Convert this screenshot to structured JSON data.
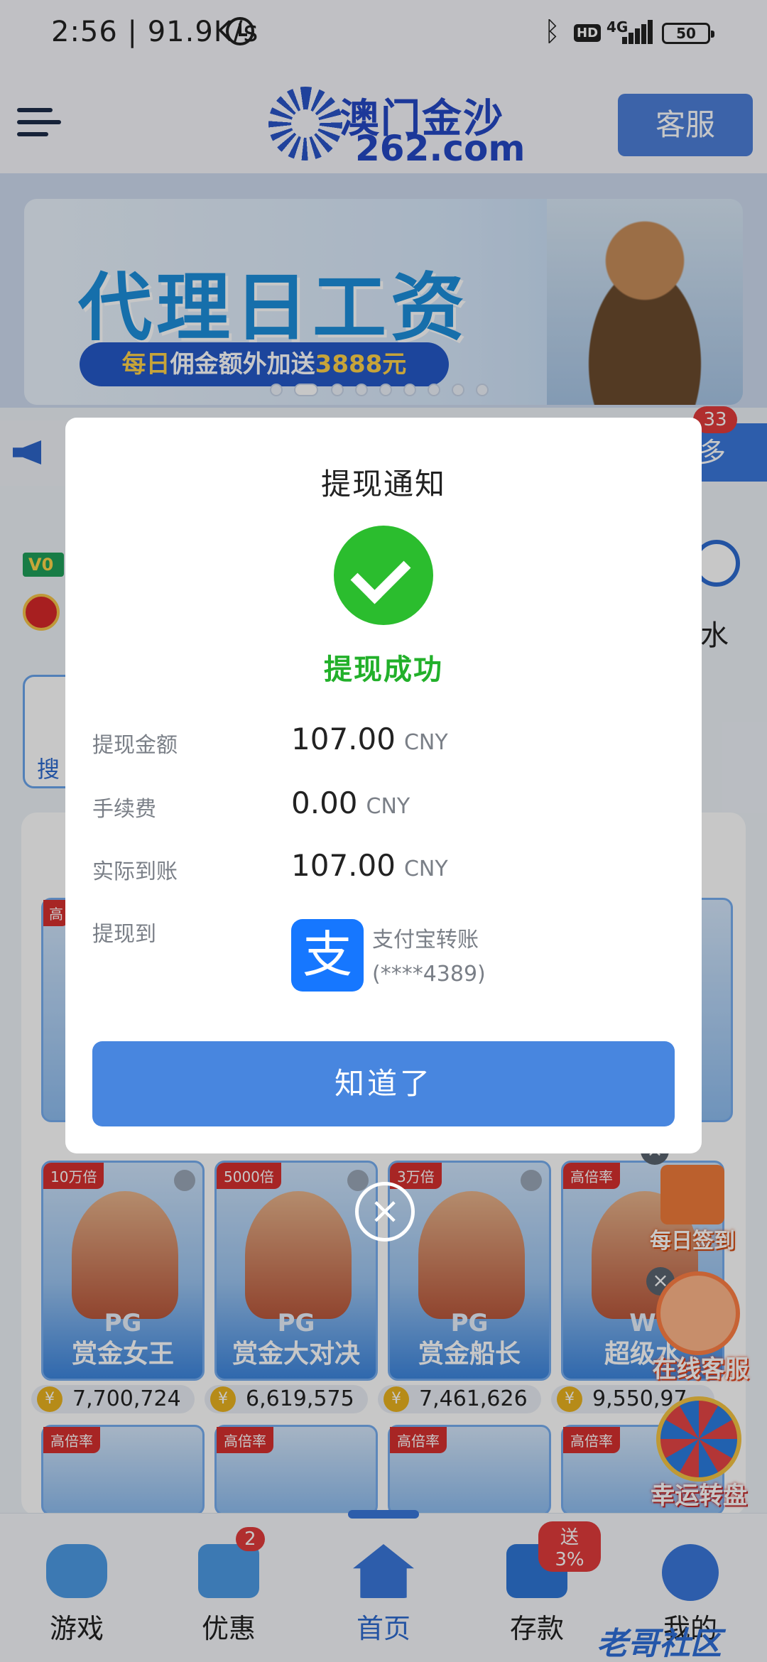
{
  "status_bar": {
    "time": "2:56 | 91.9K/s",
    "network": "4G",
    "battery": "50"
  },
  "header": {
    "logo_cn": "澳门金沙",
    "logo_url": "262.com",
    "service_label": "客服"
  },
  "banner": {
    "title": "代理日工资",
    "subtitle_prefix": "每日",
    "subtitle_mid": "佣金额外加送",
    "subtitle_amount": "3888元"
  },
  "notice": {
    "badge_count": "33",
    "more_label": "多"
  },
  "side": {
    "vip_label": "V0",
    "water_label": "水",
    "search_label": "搜"
  },
  "games": [
    {
      "tag": "10万倍",
      "brand": "PG",
      "name": "赏金女王",
      "jackpot": "7,700,724"
    },
    {
      "tag": "5000倍",
      "brand": "PG",
      "name": "赏金大对决",
      "jackpot": "6,619,575"
    },
    {
      "tag": "3万倍",
      "brand": "PG",
      "name": "赏金船长",
      "jackpot": "7,461,626"
    },
    {
      "tag": "高倍率",
      "brand": "W",
      "name": "超级水",
      "jackpot": "9,550,97"
    }
  ],
  "games_row3_tags": [
    "高倍率",
    "高倍率",
    "高倍率",
    "高倍率"
  ],
  "games_top_tag": "高",
  "floaters": {
    "sign_in": "每日签到",
    "online_service": "在线客服",
    "lucky_wheel": "幸运转盘"
  },
  "bottom_nav": [
    {
      "label": "游戏",
      "icon": "gamepad-icon"
    },
    {
      "label": "优惠",
      "icon": "gift-icon",
      "badge": "2"
    },
    {
      "label": "首页",
      "icon": "home-icon"
    },
    {
      "label": "存款",
      "icon": "wallet-icon",
      "badge": "送3%"
    },
    {
      "label": "我的",
      "icon": "user-icon"
    }
  ],
  "modal": {
    "title": "提现通知",
    "status": "提现成功",
    "rows": [
      {
        "label": "提现金额",
        "value": "107.00",
        "unit": "CNY"
      },
      {
        "label": "手续费",
        "value": "0.00",
        "unit": "CNY"
      },
      {
        "label": "实际到账",
        "value": "107.00",
        "unit": "CNY"
      }
    ],
    "dest_label": "提现到",
    "dest_icon_text": "支",
    "dest_name": "支付宝转账",
    "dest_account": "(****4389)",
    "confirm_label": "知道了"
  },
  "watermark": "老哥社区",
  "colors": {
    "accent": "#4886df",
    "success": "#22b02a",
    "alipay": "#1677ff",
    "badge": "#e23b3b"
  }
}
